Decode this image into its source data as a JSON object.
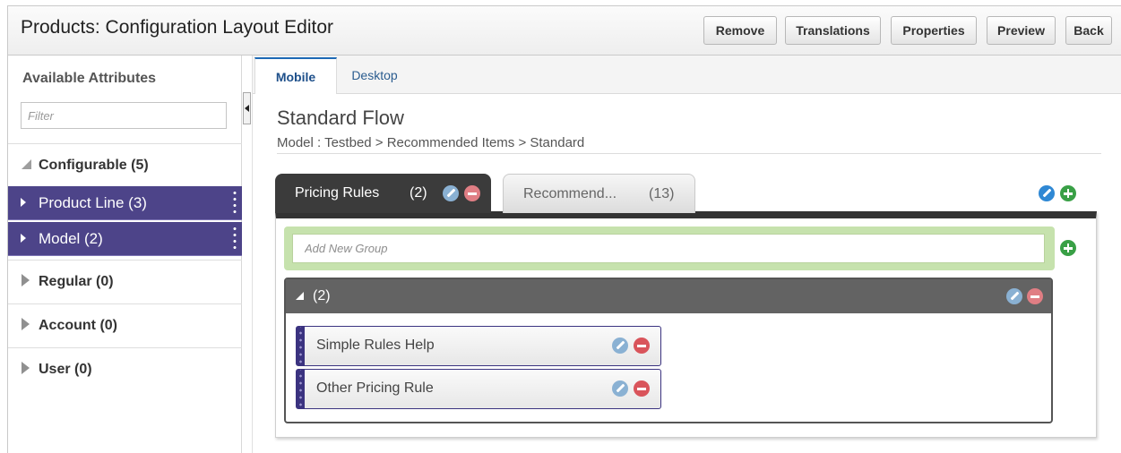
{
  "header": {
    "title": "Products: Configuration Layout Editor",
    "buttons": {
      "remove": "Remove",
      "translations": "Translations",
      "properties": "Properties",
      "preview": "Preview",
      "back": "Back"
    }
  },
  "sidebar": {
    "title": "Available Attributes",
    "filter_placeholder": "Filter",
    "sections": [
      {
        "label": "Configurable (5)",
        "expanded": true
      },
      {
        "label": "Regular (0)",
        "expanded": false
      },
      {
        "label": "Account (0)",
        "expanded": false
      },
      {
        "label": "User (0)",
        "expanded": false
      }
    ],
    "configurable_items": [
      {
        "label": "Product Line (3)"
      },
      {
        "label": "Model (2)"
      }
    ]
  },
  "tabs": [
    {
      "label": "Mobile",
      "active": true
    },
    {
      "label": "Desktop",
      "active": false
    }
  ],
  "flow": {
    "title": "Standard Flow",
    "path": "Model : Testbed > Recommended Items > Standard"
  },
  "inner_tabs": [
    {
      "label": "Pricing Rules",
      "count": "(2)",
      "active": true
    },
    {
      "label": "Recommend...",
      "count": "(13)",
      "active": false
    }
  ],
  "add_group_placeholder": "Add New Group",
  "group": {
    "label": "(2)",
    "items": [
      {
        "label": "Simple Rules Help"
      },
      {
        "label": "Other Pricing Rule"
      }
    ]
  },
  "icons": {
    "edit": "pencil-icon",
    "delete": "minus-circle-icon",
    "add": "plus-circle-icon"
  },
  "colors": {
    "accent_purple": "#4d4489",
    "tab_active_dark": "#3b3b3b",
    "add_group_green": "#c6e2ad",
    "edit_blue": "#2f88d4",
    "delete_red": "#d9545b",
    "add_green": "#39a046"
  }
}
